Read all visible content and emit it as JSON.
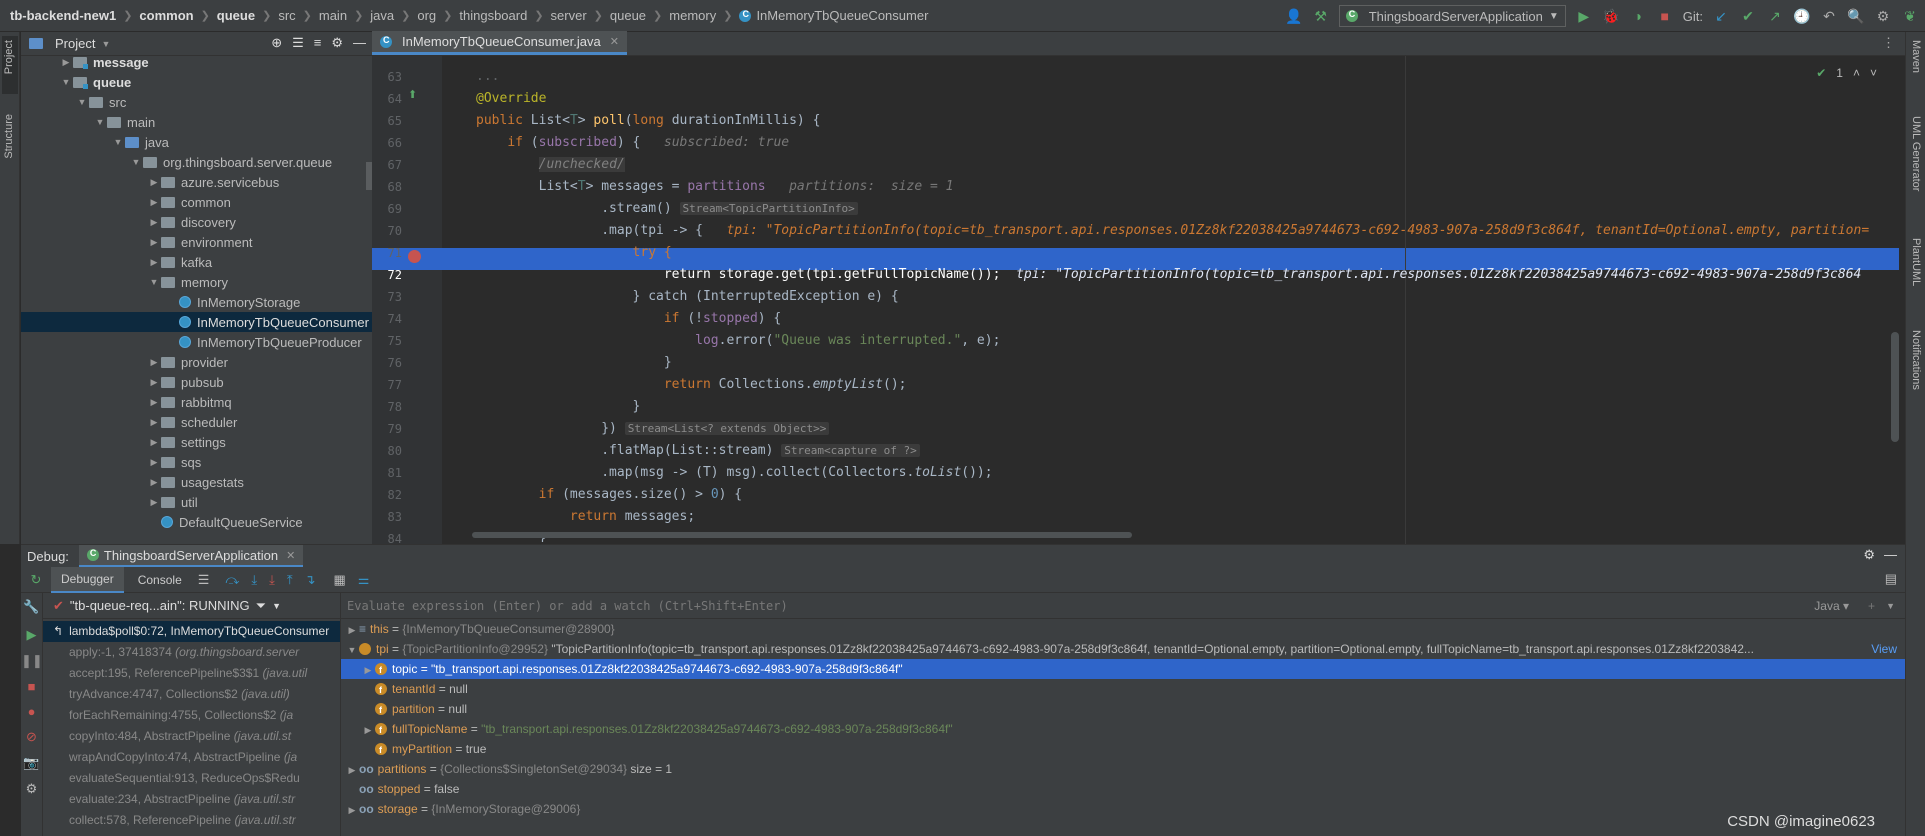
{
  "breadcrumb": [
    "tb-backend-new1",
    "common",
    "queue",
    "src",
    "main",
    "java",
    "org",
    "thingsboard",
    "server",
    "queue",
    "memory",
    "InMemoryTbQueueConsumer"
  ],
  "run_config": "ThingsboardServerApplication",
  "git_label": "Git:",
  "left_strip": {
    "project": "Project",
    "structure": "Structure"
  },
  "right_strip": {
    "maven": "Maven",
    "uml": "UML Generator",
    "plantuml": "PlantUML",
    "notifications": "Notifications"
  },
  "project_panel": {
    "title": "Project",
    "tree": [
      {
        "label": "message",
        "bold": true
      },
      {
        "label": "queue",
        "bold": true
      },
      {
        "label": "src"
      },
      {
        "label": "main"
      },
      {
        "label": "java"
      },
      {
        "label": "org.thingsboard.server.queue"
      },
      {
        "label": "azure.servicebus"
      },
      {
        "label": "common"
      },
      {
        "label": "discovery"
      },
      {
        "label": "environment"
      },
      {
        "label": "kafka"
      },
      {
        "label": "memory"
      },
      {
        "label": "InMemoryStorage"
      },
      {
        "label": "InMemoryTbQueueConsumer"
      },
      {
        "label": "InMemoryTbQueueProducer"
      },
      {
        "label": "provider"
      },
      {
        "label": "pubsub"
      },
      {
        "label": "rabbitmq"
      },
      {
        "label": "scheduler"
      },
      {
        "label": "settings"
      },
      {
        "label": "sqs"
      },
      {
        "label": "usagestats"
      },
      {
        "label": "util"
      },
      {
        "label": "DefaultQueueService"
      }
    ]
  },
  "editor": {
    "tab": "InMemoryTbQueueConsumer.java",
    "problems": "1",
    "line_numbers": [
      "63",
      "64",
      "65",
      "66",
      "67",
      "68",
      "69",
      "70",
      "71",
      "72",
      "73",
      "74",
      "75",
      "76",
      "77",
      "78",
      "79",
      "80",
      "81",
      "82",
      "83",
      "84"
    ],
    "hints": {
      "subscribed": "subscribed: true",
      "partitions": "partitions:  size = 1",
      "stream": "Stream<TopicPartitionInfo>",
      "tpi": "tpi: \"TopicPartitionInfo(topic=tb_transport.api.responses.01Zz8kf22038425a9744673-c692-4983-907a-258d9f3c864f, tenantId=Optional.empty, partition=",
      "tpi72": "tpi: \"TopicPartitionInfo(topic=tb_transport.api.responses.01Zz8kf22038425a9744673-c692-4983-907a-258d9f3c864",
      "streamlist": "Stream<List<? extends Object>>",
      "capture": "Stream<capture of ?>"
    },
    "lines": {
      "l64": "@Override",
      "l66_cond": "subscribed",
      "l67": "/unchecked/",
      "l68_var": "messages",
      "l68_fld": "partitions",
      "l69": ".stream()",
      "l70": ".map(tpi -> {",
      "l71": "try {",
      "l72_fld": "storage",
      "l72_rest": ".get(tpi.getFullTopicName());",
      "l73": "} catch (InterruptedException e) {",
      "l74_fld": "stopped",
      "l75_fld": "log",
      "l75_str": "\"Queue was interrupted.\"",
      "l76": "}",
      "l77_fn": "emptyList",
      "l78": "}",
      "l79": "})",
      "l80": ".flatMap(List::stream)",
      "l81": ".map(msg -> (T) msg).collect(Collectors.",
      "l81_fn": "toList",
      "l82_num": "0",
      "l83_kw": "return",
      "l83_rest": "messages;",
      "l84": "}"
    }
  },
  "debug": {
    "label": "Debug:",
    "session": "ThingsboardServerApplication",
    "tabs": [
      "Debugger",
      "Console"
    ],
    "thread": "\"tb-queue-req...ain\": RUNNING",
    "eval_placeholder": "Evaluate expression (Enter) or add a watch (Ctrl+Shift+Enter)",
    "lang": "Java",
    "frames": [
      {
        "text": "lambda$poll$0:72, InMemoryTbQueueConsumer",
        "pkg": ""
      },
      {
        "text": "apply:-1, 37418374 ",
        "pkg": "(org.thingsboard.server"
      },
      {
        "text": "accept:195, ReferencePipeline$3$1 ",
        "pkg": "(java.util"
      },
      {
        "text": "tryAdvance:4747, Collections$2 ",
        "pkg": "(java.util)"
      },
      {
        "text": "forEachRemaining:4755, Collections$2 ",
        "pkg": "(ja"
      },
      {
        "text": "copyInto:484, AbstractPipeline ",
        "pkg": "(java.util.st"
      },
      {
        "text": "wrapAndCopyInto:474, AbstractPipeline ",
        "pkg": "(ja"
      },
      {
        "text": "evaluateSequential:913, ReduceOps$Redu",
        "pkg": ""
      },
      {
        "text": "evaluate:234, AbstractPipeline ",
        "pkg": "(java.util.str"
      },
      {
        "text": "collect:578, ReferencePipeline ",
        "pkg": "(java.util.str"
      }
    ],
    "variables": [
      {
        "name": "this",
        "value": "{InMemoryTbQueueConsumer@28900}"
      },
      {
        "name": "tpi",
        "type": "{TopicPartitionInfo@29952}",
        "value": "\"TopicPartitionInfo(topic=tb_transport.api.responses.01Zz8kf22038425a9744673-c692-4983-907a-258d9f3c864f, tenantId=Optional.empty, partition=Optional.empty, fullTopicName=tb_transport.api.responses.01Zz8kf2203842...",
        "view": "View"
      },
      {
        "name": "topic",
        "value": "\"tb_transport.api.responses.01Zz8kf22038425a9744673-c692-4983-907a-258d9f3c864f\""
      },
      {
        "name": "tenantId",
        "value": "null"
      },
      {
        "name": "partition",
        "value": "null"
      },
      {
        "name": "fullTopicName",
        "value": "\"tb_transport.api.responses.01Zz8kf22038425a9744673-c692-4983-907a-258d9f3c864f\""
      },
      {
        "name": "myPartition",
        "value": "true"
      },
      {
        "name": "partitions",
        "type": "{Collections$SingletonSet@29034}",
        "value": "size = 1"
      },
      {
        "name": "stopped",
        "value": "false"
      },
      {
        "name": "storage",
        "value": "{InMemoryStorage@29006}"
      }
    ]
  },
  "watermark": "CSDN @imagine0623"
}
